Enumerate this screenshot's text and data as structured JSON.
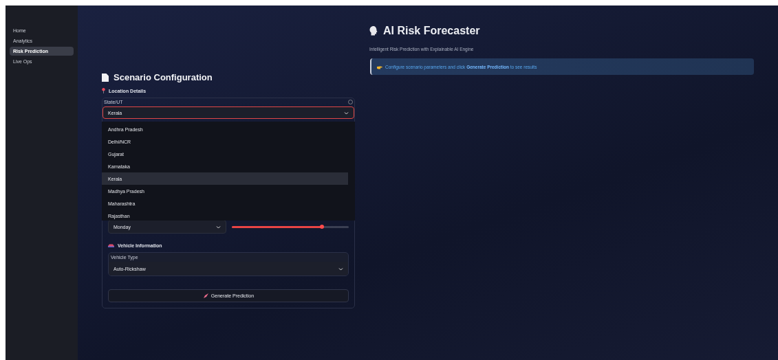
{
  "sidebar": {
    "items": [
      {
        "label": "Home",
        "selected": false
      },
      {
        "label": "Analytics",
        "selected": false
      },
      {
        "label": "Risk Prediction",
        "selected": true
      },
      {
        "label": "Live Ops",
        "selected": false
      }
    ]
  },
  "header": {
    "title": "AI Risk Forecaster",
    "subtitle": "Intelligent Risk Prediction with Explainable AI Engine"
  },
  "config": {
    "title": "Scenario Configuration",
    "location_heading": "Location Details",
    "state_field": {
      "label": "State/UT",
      "value": "Kerala",
      "expanded": true
    },
    "state_options": [
      {
        "label": "Andhra Pradesh",
        "selected": false
      },
      {
        "label": "Delhi/NCR",
        "selected": false
      },
      {
        "label": "Gujarat",
        "selected": false
      },
      {
        "label": "Karnataka",
        "selected": false
      },
      {
        "label": "Kerala",
        "selected": true
      },
      {
        "label": "Madhya Pradesh",
        "selected": false
      },
      {
        "label": "Maharashtra",
        "selected": false
      },
      {
        "label": "Rajasthan",
        "selected": false
      }
    ],
    "day_field": {
      "value": "Monday"
    },
    "slider": {
      "level": 0.77
    },
    "vehicle_heading": "Vehicle Information",
    "vehicle_field": {
      "label": "Vehicle Type",
      "value": "Auto-Rickshaw"
    },
    "button": "Generate Prediction"
  },
  "info": "Configure scenario parameters and click **Generate Prediction** to see results"
}
